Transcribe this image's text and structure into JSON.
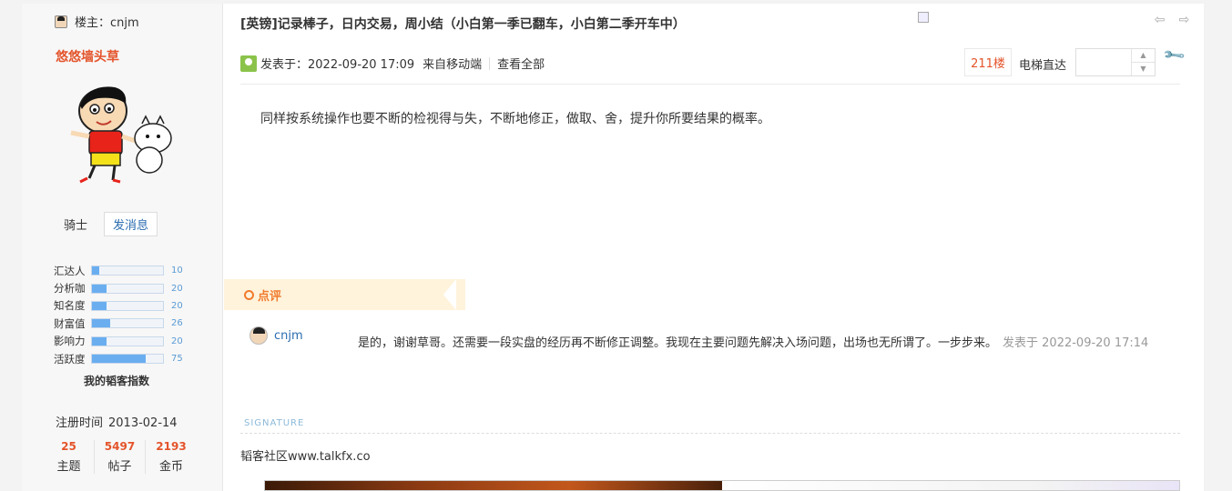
{
  "sidebar": {
    "louzhu_label": "楼主：cnjm",
    "username": "悠悠墙头草",
    "rank": "骑士",
    "send_message": "发消息",
    "stats": [
      {
        "label": "汇达人",
        "value": "10",
        "fraction": 0.1
      },
      {
        "label": "分析咖",
        "value": "20",
        "fraction": 0.2
      },
      {
        "label": "知名度",
        "value": "20",
        "fraction": 0.2
      },
      {
        "label": "财富值",
        "value": "26",
        "fraction": 0.26
      },
      {
        "label": "影响力",
        "value": "20",
        "fraction": 0.2
      },
      {
        "label": "活跃度",
        "value": "75",
        "fraction": 0.75
      }
    ],
    "index_title": "我的韬客指数",
    "register_label": "注册时间",
    "register_date": "2013-02-14",
    "counts": [
      {
        "num": "25",
        "label": "主题"
      },
      {
        "num": "5497",
        "label": "帖子"
      },
      {
        "num": "2193",
        "label": "金币"
      }
    ]
  },
  "post": {
    "title": "[英镑]记录棒子，日内交易，周小结（小白第一季已翻车，小白第二季开车中）",
    "posted_label": "发表于：2022-09-20 17:09",
    "from_label": "来自移动端",
    "view_all": "查看全部",
    "floor": "211楼",
    "jump_label": "电梯直达",
    "floor_input_value": "",
    "content": "同样按系统操作也要不断的检视得与失，不断地修正，做取、舍，提升你所要结果的概率。"
  },
  "comments": {
    "header": "点评",
    "items": [
      {
        "user": "cnjm",
        "text": "是的，谢谢草哥。还需要一段实盘的经历再不断修正调整。我现在主要问题先解决入场问题，出场也无所谓了。一步步来。",
        "time": "发表于 2022-09-20 17:14"
      }
    ]
  },
  "signature": {
    "label": "SIGNATURE",
    "text": "韬客社区www.talkfx.co"
  },
  "icons": {
    "prev": "arrow-left-icon",
    "next": "arrow-right-icon",
    "tool": "wrench-icon",
    "online": "online-status-icon"
  },
  "colors": {
    "accent": "#e4542b",
    "link": "#2b6cb0",
    "comment_accent": "#f07b2d"
  }
}
